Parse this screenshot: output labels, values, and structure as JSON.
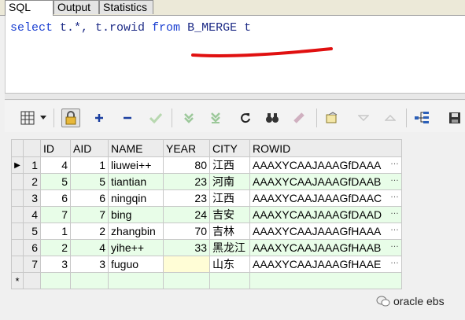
{
  "tabs": [
    "SQL",
    "Output",
    "Statistics"
  ],
  "editor": {
    "kw_select": "select",
    "part1": " t.*, t.rowid ",
    "kw_from": "from",
    "part2": " B_MERGE t"
  },
  "toolbar_icons": [
    "grid-menu-icon",
    "dropdown-arrow-icon",
    "lock-icon",
    "add-record-icon",
    "delete-record-icon",
    "post-changes-icon",
    "fetch-next-icon",
    "fetch-last-icon",
    "refresh-icon",
    "find-icon",
    "clear-icon",
    "export-icon",
    "sort-up-icon",
    "sort-down-icon",
    "query-builder-icon",
    "save-icon"
  ],
  "grid": {
    "columns": [
      "",
      "",
      "ID",
      "AID",
      "NAME",
      "YEAR",
      "CITY",
      "ROWID"
    ],
    "rows": [
      {
        "n": "1",
        "id": "4",
        "aid": "1",
        "name": "liuwei++",
        "year": "80",
        "city": "江西",
        "rowid": "AAAXYCAAJAAAGfDAAA"
      },
      {
        "n": "2",
        "id": "5",
        "aid": "5",
        "name": "tiantian",
        "year": "23",
        "city": "河南",
        "rowid": "AAAXYCAAJAAAGfDAAB"
      },
      {
        "n": "3",
        "id": "6",
        "aid": "6",
        "name": "ningqin",
        "year": "23",
        "city": "江西",
        "rowid": "AAAXYCAAJAAAGfDAAC"
      },
      {
        "n": "4",
        "id": "7",
        "aid": "7",
        "name": "bing",
        "year": "24",
        "city": "吉安",
        "rowid": "AAAXYCAAJAAAGfDAAD"
      },
      {
        "n": "5",
        "id": "1",
        "aid": "2",
        "name": "zhangbin",
        "year": "70",
        "city": "吉林",
        "rowid": "AAAXYCAAJAAAGfHAAA"
      },
      {
        "n": "6",
        "id": "2",
        "aid": "4",
        "name": "yihe++",
        "year": "33",
        "city": "黑龙江",
        "rowid": "AAAXYCAAJAAAGfHAAB"
      },
      {
        "n": "7",
        "id": "3",
        "aid": "3",
        "name": "fuguo",
        "year": "",
        "city": "山东",
        "rowid": "AAAXYCAAJAAAGfHAAE"
      }
    ],
    "new_row_marker": "*",
    "current_row_marker": "▶",
    "cell_button": "…"
  },
  "watermark": "oracle ebs"
}
